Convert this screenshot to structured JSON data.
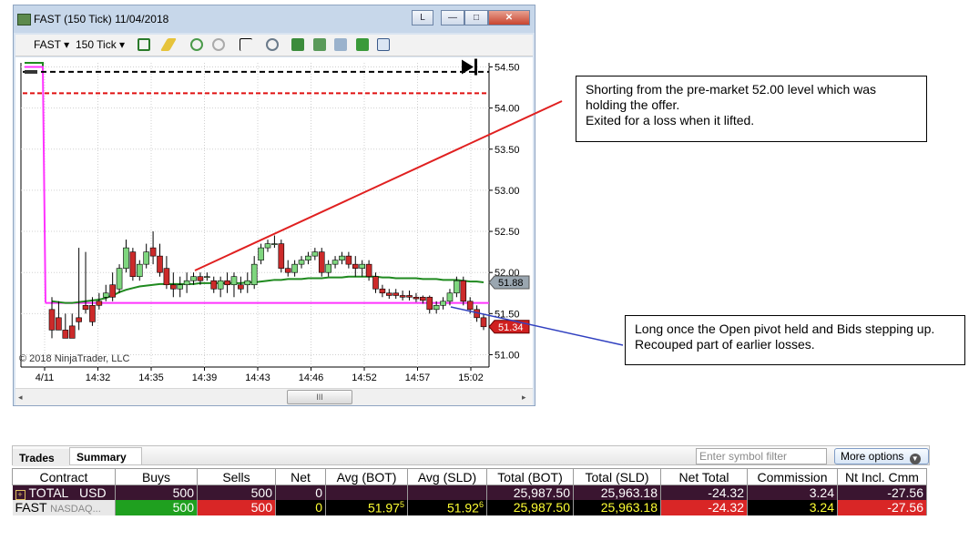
{
  "window": {
    "title": "FAST (150 Tick)  11/04/2018",
    "caption_buttons": [
      "L",
      "—",
      "□",
      "✕"
    ]
  },
  "toolbar": {
    "instrument": "FAST ▾",
    "interval": "150 Tick ▾"
  },
  "chart_data": {
    "type": "candlestick",
    "title": "",
    "copyright": "© 2018 NinjaTrader, LLC",
    "y_ticks": [
      "54.50",
      "54.00",
      "53.50",
      "53.00",
      "52.50",
      "52.00",
      "51.50",
      "51.00"
    ],
    "x_ticks": [
      "4/11",
      "14:32",
      "14:35",
      "14:39",
      "14:43",
      "14:46",
      "14:52",
      "14:57",
      "15:02"
    ],
    "ylim": [
      50.85,
      54.55
    ],
    "price_marker": "51.88",
    "last_price_marker": "51.34",
    "levels": {
      "black_dashed": 54.44,
      "red_dashed": 54.18,
      "magenta": 51.63
    },
    "candles": [
      [
        51.55,
        51.7,
        51.3,
        51.2
      ],
      [
        51.45,
        51.65,
        51.3,
        51.3
      ],
      [
        51.3,
        51.5,
        51.2,
        51.2
      ],
      [
        51.35,
        51.5,
        51.2,
        51.25
      ],
      [
        51.45,
        52.3,
        51.4,
        51.3
      ],
      [
        51.6,
        52.25,
        51.55,
        51.5
      ],
      [
        51.6,
        51.7,
        51.4,
        51.35
      ],
      [
        51.65,
        51.75,
        51.6,
        51.55
      ],
      [
        51.7,
        51.85,
        51.75,
        51.65
      ],
      [
        51.85,
        52.0,
        51.7,
        51.65
      ],
      [
        51.8,
        52.1,
        52.05,
        51.75
      ],
      [
        52.05,
        52.4,
        52.3,
        52.0
      ],
      [
        52.25,
        52.3,
        51.95,
        51.9
      ],
      [
        51.95,
        52.15,
        52.1,
        51.9
      ],
      [
        52.1,
        52.35,
        52.25,
        52.05
      ],
      [
        52.3,
        52.5,
        52.2,
        52.1
      ],
      [
        52.2,
        52.35,
        52.0,
        51.95
      ],
      [
        52.05,
        52.2,
        51.85,
        51.8
      ],
      [
        51.85,
        52.0,
        51.8,
        51.7
      ],
      [
        51.8,
        51.95,
        51.85,
        51.7
      ],
      [
        51.85,
        52.0,
        51.9,
        51.75
      ],
      [
        51.9,
        52.0,
        51.95,
        51.85
      ],
      [
        51.95,
        52.0,
        51.9,
        51.85
      ],
      [
        51.95,
        52.0,
        51.95,
        51.9
      ],
      [
        51.9,
        51.95,
        51.8,
        51.75
      ],
      [
        51.8,
        51.95,
        51.9,
        51.7
      ],
      [
        51.9,
        52.0,
        51.85,
        51.75
      ],
      [
        51.85,
        52.0,
        51.95,
        51.7
      ],
      [
        51.85,
        51.95,
        51.8,
        51.75
      ],
      [
        51.85,
        52.0,
        51.9,
        51.75
      ],
      [
        51.85,
        52.2,
        52.1,
        51.8
      ],
      [
        52.15,
        52.35,
        52.3,
        52.1
      ],
      [
        52.3,
        52.4,
        52.35,
        52.25
      ],
      [
        52.35,
        52.45,
        52.35,
        52.3
      ],
      [
        52.35,
        52.4,
        52.05,
        52.0
      ],
      [
        52.05,
        52.15,
        52.0,
        51.95
      ],
      [
        52.0,
        52.15,
        52.1,
        51.95
      ],
      [
        52.1,
        52.2,
        52.15,
        52.05
      ],
      [
        52.15,
        52.25,
        52.2,
        52.1
      ],
      [
        52.2,
        52.3,
        52.25,
        52.15
      ],
      [
        52.25,
        52.3,
        52.0,
        51.95
      ],
      [
        52.0,
        52.15,
        52.1,
        51.95
      ],
      [
        52.1,
        52.2,
        52.15,
        52.05
      ],
      [
        52.15,
        52.25,
        52.2,
        52.1
      ],
      [
        52.2,
        52.25,
        52.1,
        52.05
      ],
      [
        52.1,
        52.2,
        52.05,
        51.95
      ],
      [
        52.05,
        52.15,
        52.1,
        51.95
      ],
      [
        52.1,
        52.15,
        51.95,
        51.9
      ],
      [
        51.95,
        52.0,
        51.8,
        51.75
      ],
      [
        51.8,
        51.85,
        51.75,
        51.7
      ],
      [
        51.75,
        51.8,
        51.72,
        51.68
      ],
      [
        51.75,
        51.8,
        51.72,
        51.68
      ],
      [
        51.72,
        51.78,
        51.7,
        51.66
      ],
      [
        51.72,
        51.78,
        51.7,
        51.66
      ],
      [
        51.7,
        51.75,
        51.68,
        51.64
      ],
      [
        51.7,
        51.72,
        51.66,
        51.62
      ],
      [
        51.7,
        51.72,
        51.55,
        51.5
      ],
      [
        51.55,
        51.65,
        51.6,
        51.5
      ],
      [
        51.6,
        51.7,
        51.65,
        51.55
      ],
      [
        51.65,
        51.8,
        51.75,
        51.6
      ],
      [
        51.75,
        51.95,
        51.9,
        51.7
      ],
      [
        51.9,
        51.95,
        51.65,
        51.6
      ],
      [
        51.65,
        51.7,
        51.55,
        51.5
      ],
      [
        51.55,
        51.6,
        51.45,
        51.4
      ],
      [
        51.45,
        51.5,
        51.34,
        51.3
      ]
    ],
    "vwap": [
      51.65,
      51.64,
      51.63,
      51.63,
      51.64,
      51.65,
      51.66,
      51.67,
      51.69,
      51.72,
      51.76,
      51.79,
      51.81,
      51.83,
      51.84,
      51.85,
      51.86,
      51.86,
      51.86,
      51.86,
      51.86,
      51.86,
      51.87,
      51.87,
      51.87,
      51.87,
      51.87,
      51.87,
      51.87,
      51.88,
      51.88,
      51.89,
      51.9,
      51.91,
      51.91,
      51.92,
      51.92,
      51.92,
      51.93,
      51.93,
      51.93,
      51.94,
      51.94,
      51.94,
      51.95,
      51.95,
      51.95,
      51.95,
      51.95,
      51.94,
      51.94,
      51.93,
      51.93,
      51.93,
      51.93,
      51.92,
      51.92,
      51.92,
      51.91,
      51.91,
      51.91,
      51.9,
      51.89,
      51.89,
      51.88
    ]
  },
  "notes": {
    "top": [
      "Shorting from the pre-market 52.00 level which was",
      "holding the offer.",
      "Exited for a loss when it lifted."
    ],
    "bottom": [
      "Long once the Open pivot held and Bids stepping up.",
      "Recouped part of earlier losses."
    ]
  },
  "colors": {
    "up": "#7fd67f",
    "down": "#cc2a2a",
    "vwap": "#1f8a1f",
    "magenta": "#ff33ff",
    "red_line": "#e02020",
    "blue_line": "#3040c0"
  },
  "trades_panel": {
    "tabs": [
      "Trades",
      "Summary"
    ],
    "filter_placeholder": "Enter symbol filter",
    "more_options": "More options",
    "columns": [
      "Contract",
      "Buys",
      "Sells",
      "Net",
      "Avg (BOT)",
      "Avg (SLD)",
      "Total (BOT)",
      "Total (SLD)",
      "Net Total",
      "Commission",
      "Nt Incl. Cmm"
    ],
    "total_row": {
      "contract": "TOTAL",
      "currency": "USD",
      "buys": "500",
      "sells": "500",
      "net": "0",
      "avg_bot": "",
      "avg_sld": "",
      "total_bot": "25,987.50",
      "total_sld": "25,963.18",
      "net_total": "-24.32",
      "commission": "3.24",
      "nt_incl": "-27.56"
    },
    "fast_row": {
      "contract": "FAST",
      "exchange": "NASDAQ...",
      "buys": "500",
      "sells": "500",
      "net": "0",
      "avg_bot": "51.97",
      "avg_bot_sup": "5",
      "avg_sld": "51.92",
      "avg_sld_sup": "6",
      "total_bot": "25,987.50",
      "total_sld": "25,963.18",
      "net_total": "-24.32",
      "commission": "3.24",
      "nt_incl": "-27.56"
    }
  }
}
